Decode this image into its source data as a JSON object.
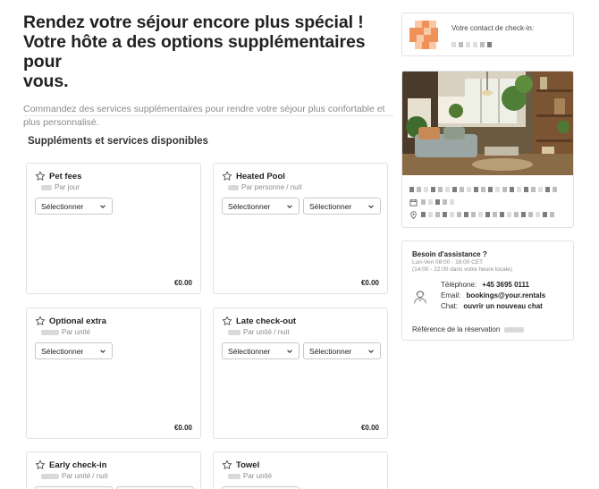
{
  "page": {
    "headline": [
      "Rendez votre séjour encore plus spécial !",
      "Votre hôte a des options supplémentaires pour",
      "vous."
    ],
    "subtitle": "Commandez des services supplémentaires pour rendre votre séjour plus confortable et plus personnalisé.",
    "section_title": "Suppléments et services disponibles"
  },
  "cards": [
    {
      "title": "Pet fees",
      "unit": "Par jour",
      "select1": "Sélectionner",
      "price": "€0.00"
    },
    {
      "title": "Heated Pool",
      "unit": "Par personne / nuit",
      "select1": "Sélectionner",
      "select2": "Sélectionner",
      "price": "€0.00"
    },
    {
      "title": "Optional extra",
      "unit": "Par unité",
      "select1": "Sélectionner",
      "price": "€0.00"
    },
    {
      "title": "Late check-out",
      "unit": "Par unité / nuit",
      "select1": "Sélectionner",
      "select2": "Sélectionner",
      "price": "€0.00"
    },
    {
      "title": "Early check-in",
      "unit": "Par unité / nuit"
    },
    {
      "title": "Towel",
      "unit": "Par unité"
    }
  ],
  "contact": {
    "label": "Votre contact de check-in:"
  },
  "help": {
    "title": "Besoin d'assistance ?",
    "hours_line1": "Lun-Ven 08:00 - 16:00 CET",
    "hours_line2": "(14:00 - 22:00 dans votre heure locale)",
    "phone_label": "Téléphone:",
    "phone_value": "+45 3695 0111",
    "email_label": "Email:",
    "email_value": "bookings@your.rentals",
    "chat_label": "Chat:",
    "chat_value": "ouvrir un nouveau chat",
    "reference_label": "Référence de la réservation"
  },
  "colors": {
    "avatar_orange": "#f0915a",
    "avatar_peach": "#f7c9a7",
    "border": "#e2e2e2",
    "muted_text": "#8a8a8a"
  },
  "icons": [
    "star-icon",
    "chevron-down-icon",
    "calendar-icon",
    "location-pin-icon",
    "support-agent-icon"
  ]
}
